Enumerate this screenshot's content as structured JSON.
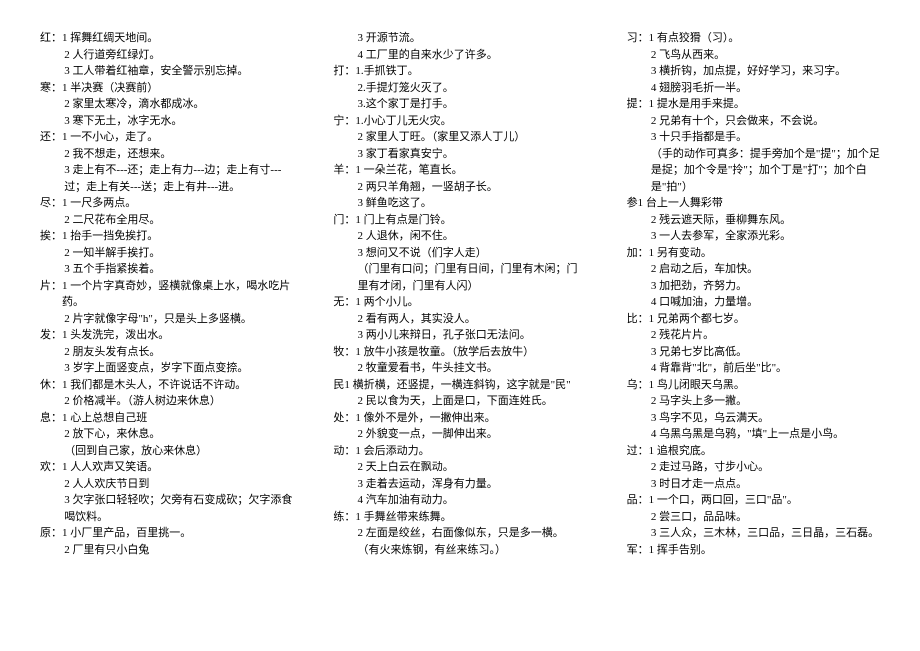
{
  "columns": [
    [
      {
        "head": "红：",
        "items": [
          "1 挥舞红绸天地间。",
          "2 人行道旁红绿灯。",
          "3 工人带着红袖章，安全警示别忘掉。"
        ]
      },
      {
        "head": "寒：",
        "items": [
          "1 半决赛（决赛前）",
          "2 家里太寒冷，滴水都成冰。",
          "3 寒下无土，冰字无水。"
        ]
      },
      {
        "head": "还：",
        "items": [
          "1 一不小心，走了。",
          "2 我不想走，还想来。",
          "3 走上有不---还；走上有力---边；走上有寸---过；走上有关---送；走上有井---进。"
        ]
      },
      {
        "head": "尽：",
        "items": [
          "1 一尺多两点。",
          "2 二尺花布全用尽。"
        ]
      },
      {
        "head": "挨：",
        "items": [
          "1 抬手一挡免挨打。",
          "2 一知半解手挨打。",
          "3 五个手指紧挨着。"
        ]
      },
      {
        "head": "片：",
        "items": [
          "1 一个片字真奇妙，竖横就像桌上水，喝水吃片药。",
          "2 片字就像字母\"h\"，只是头上多竖横。"
        ]
      },
      {
        "head": "发：",
        "items": [
          "1 头发洗完，泼出水。",
          "2 朋友头发有点长。",
          "3 岁字上面竖变点，岁字下面点变捺。"
        ]
      },
      {
        "head": "休：",
        "items": [
          "1 我们都是木头人，不许说话不许动。",
          "2 价格减半。（游人树边来休息）"
        ]
      },
      {
        "head": "息：",
        "items": [
          "1 心上总想自己班",
          "2 放下心，来休息。",
          "（回到自己家，放心来休息）"
        ]
      },
      {
        "head": "欢：",
        "items": [
          "1 人人欢声又笑语。",
          "2 人人欢庆节日到",
          "3 欠字张口轻轻吹；欠旁有石变成砍；欠字添食喝饮料。"
        ],
        "unindentLast": true
      },
      {
        "head": "原：",
        "items": [
          "1 小厂里产品，百里挑一。",
          "2 厂里有只小白兔"
        ]
      }
    ],
    [
      {
        "head": "",
        "items": [
          "3 开源节流。",
          "4 工厂里的自来水少了许多。"
        ]
      },
      {
        "head": "打：",
        "items": [
          "1.手抓铁丁。",
          "2.手提灯笼火灭了。",
          "3.这个家丁是打手。"
        ]
      },
      {
        "head": "宁：",
        "items": [
          "1.小心丁儿无火灾。",
          "2 家里人丁旺。（家里又添人丁儿）",
          "3 家丁看家真安宁。"
        ]
      },
      {
        "head": "羊：",
        "items": [
          "1 一朵兰花，笔直长。",
          "2 两只羊角翘，一竖胡子长。",
          "3 鲜鱼吃这了。"
        ]
      },
      {
        "head": "门：",
        "items": [
          "1 门上有点是门铃。",
          "2 人退休，闲不住。",
          "3 想问又不说（们字人走）",
          "（门里有口问；门里有日间，门里有木闲；门里有才闭，门里有人闪）"
        ]
      },
      {
        "head": "无：",
        "items": [
          "1 两个小儿。",
          "2 看有两人，其实没人。",
          "3 两小儿来辩日，孔子张口无法问。"
        ]
      },
      {
        "head": "牧：",
        "items": [
          "1 放牛小孩是牧童。（放学后去放牛）",
          "2 牧童爱看书，牛头挂文书。"
        ]
      },
      {
        "head": "民",
        "items": [
          "1 横折横，还竖提，一横连斜钩，这字就是\"民\"",
          "2 民以食为天，上面是口，下面连姓氏。"
        ]
      },
      {
        "head": "处：",
        "items": [
          "1 像外不是外，一撇伸出来。",
          "2 外貌变一点，一脚伸出来。"
        ]
      },
      {
        "head": "动：",
        "items": [
          "1 会后添动力。",
          "2 天上白云在飘动。",
          "3 走着去运动，浑身有力量。",
          "4 汽车加油有动力。"
        ]
      },
      {
        "head": "练：",
        "items": [
          "1 手舞丝带来练舞。",
          "2 左面是绞丝，右面像似东，只是多一横。",
          "（有火来炼钢，有丝来练习。）"
        ]
      }
    ],
    [
      {
        "head": "习：",
        "items": [
          "1 有点狡猾（习）。",
          "2 飞鸟从西来。",
          "3 横折钩，加点提，好好学习，来习字。",
          "4 翅膀羽毛折一半。"
        ]
      },
      {
        "head": "提：",
        "items": [
          "1 提水是用手来提。",
          "2 兄弟有十个，只会做来，不会说。",
          "3 十只手指都是手。",
          "（手的动作可真多：提手旁加个是\"提\"；加个足是捉；加个令是\"拎\"；加个丁是\"打\"；加个白是\"拍\"）"
        ]
      },
      {
        "head": "参",
        "items": [
          "1 台上一人舞彩带",
          "2 残云遮天际，垂柳舞东风。",
          "3 一人去参军，全家添光彩。"
        ]
      },
      {
        "head": "加：",
        "items": [
          "1 另有变动。",
          "2 启动之后，车加快。",
          "3 加把劲，齐努力。",
          "4 口喊加油，力量增。"
        ]
      },
      {
        "head": "比：",
        "items": [
          "1 兄弟两个都七岁。",
          "2 残花片片。",
          "3 兄弟七岁比高低。",
          "4 背靠背\"北\"，前后坐\"比\"。"
        ]
      },
      {
        "head": "乌：",
        "items": [
          "1 鸟儿闭眼天乌黑。",
          "2 马字头上多一撇。",
          "3 鸟字不见，乌云满天。",
          "4 乌黑乌黑是乌鸦，\"填\"上一点是小鸟。"
        ]
      },
      {
        "head": "过：",
        "items": [
          "1 追根究底。",
          "2 走过马路，寸步小心。",
          "3 时日才走一点点。"
        ]
      },
      {
        "head": "品：",
        "items": [
          "1 一个口，两口回，三口\"品\"。",
          "2 尝三口，品品味。",
          "3 三人众，三木林，三口品，三日晶，三石磊。"
        ]
      },
      {
        "head": "军：",
        "items": [
          "1 挥手告别。"
        ]
      }
    ]
  ]
}
